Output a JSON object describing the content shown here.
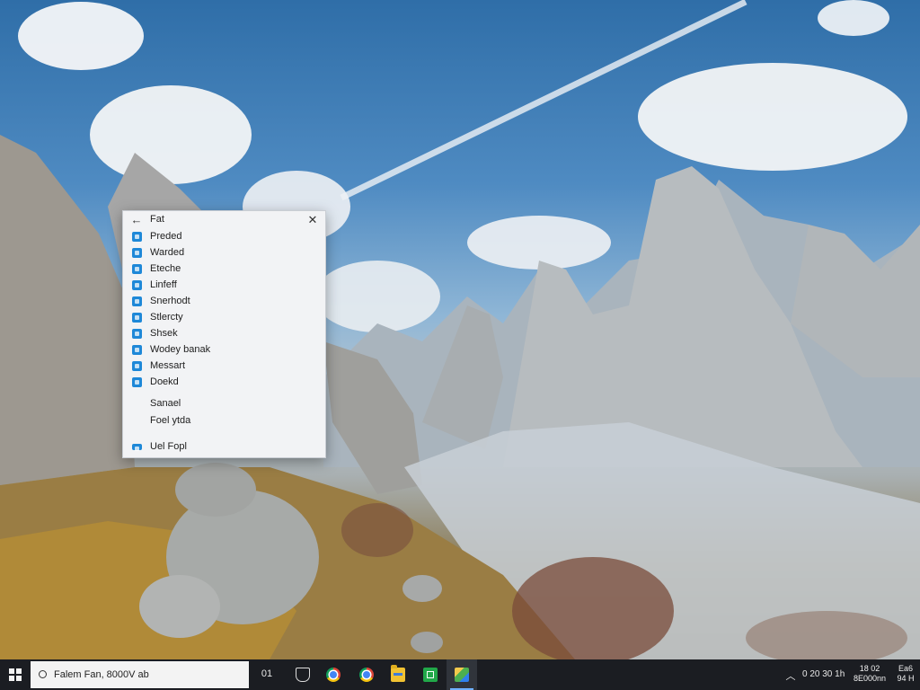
{
  "popup": {
    "title": "Fat",
    "items": [
      {
        "label": "Preded",
        "icon": "app-icon"
      },
      {
        "label": "Warded",
        "icon": "app-icon"
      },
      {
        "label": "Eteche",
        "icon": "app-icon"
      },
      {
        "label": "Linfeff",
        "icon": "app-icon"
      },
      {
        "label": "Snerhodt",
        "icon": "app-icon"
      },
      {
        "label": "Stlercty",
        "icon": "app-icon"
      },
      {
        "label": "Shsek",
        "icon": "app-icon"
      },
      {
        "label": "Wodey banak",
        "icon": "app-icon"
      },
      {
        "label": "Messart",
        "icon": "app-icon"
      },
      {
        "label": "Doekd",
        "icon": "app-icon"
      }
    ],
    "plain_items": [
      "Sanael",
      "Foel ytda"
    ],
    "footer_item": {
      "label": "Uel Fopl",
      "icon": "app-icon"
    }
  },
  "taskbar": {
    "search_text": "Falem Fan, 8000V ab",
    "task_view_label": "01",
    "apps": [
      {
        "name": "security",
        "icon": "shield-icon"
      },
      {
        "name": "chrome",
        "icon": "chrome-icon"
      },
      {
        "name": "chrome-2",
        "icon": "chrome-icon"
      },
      {
        "name": "file-explorer",
        "icon": "folder-icon"
      },
      {
        "name": "green-app",
        "icon": "app-icon"
      },
      {
        "name": "photos",
        "icon": "photos-icon"
      }
    ],
    "tray_text": "0 20 30 1h",
    "clock_line1": "18 02",
    "clock_line2": "8E000nn",
    "notif_line1": "Ea6",
    "notif_line2": "94 H"
  },
  "colors": {
    "accent": "#1e88d8",
    "taskbar_bg": "#1b1d22",
    "popup_bg": "#f2f3f5"
  }
}
